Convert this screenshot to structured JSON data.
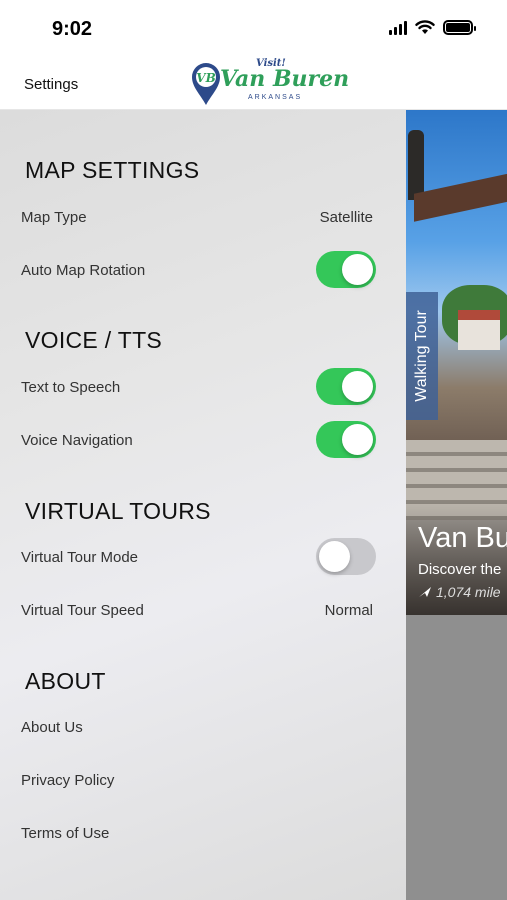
{
  "status_bar": {
    "time": "9:02"
  },
  "header": {
    "settings_label": "Settings",
    "logo": {
      "visit": "Visit!",
      "initials": "VB",
      "name": "Van Buren",
      "state": "ARKANSAS"
    }
  },
  "sections": {
    "map_settings": {
      "title": "MAP SETTINGS",
      "map_type_label": "Map Type",
      "map_type_value": "Satellite",
      "auto_rotation_label": "Auto Map Rotation",
      "auto_rotation_on": true
    },
    "voice": {
      "title": "VOICE / TTS",
      "tts_label": "Text to Speech",
      "tts_on": true,
      "voice_nav_label": "Voice Navigation",
      "voice_nav_on": true
    },
    "virtual_tours": {
      "title": "VIRTUAL TOURS",
      "mode_label": "Virtual Tour Mode",
      "mode_on": false,
      "speed_label": "Virtual Tour Speed",
      "speed_value": "Normal"
    },
    "about": {
      "title": "ABOUT",
      "about_us": "About Us",
      "privacy": "Privacy Policy",
      "terms": "Terms of Use"
    }
  },
  "tour_card": {
    "tag": "Walking Tour",
    "title": "Van Bu",
    "subtitle": "Discover the",
    "distance": "1,074 mile"
  },
  "colors": {
    "toggle_on": "#34c759",
    "toggle_off": "#c8c8cc",
    "logo_green": "#2f9f5a",
    "logo_blue": "#2d4a8a"
  }
}
